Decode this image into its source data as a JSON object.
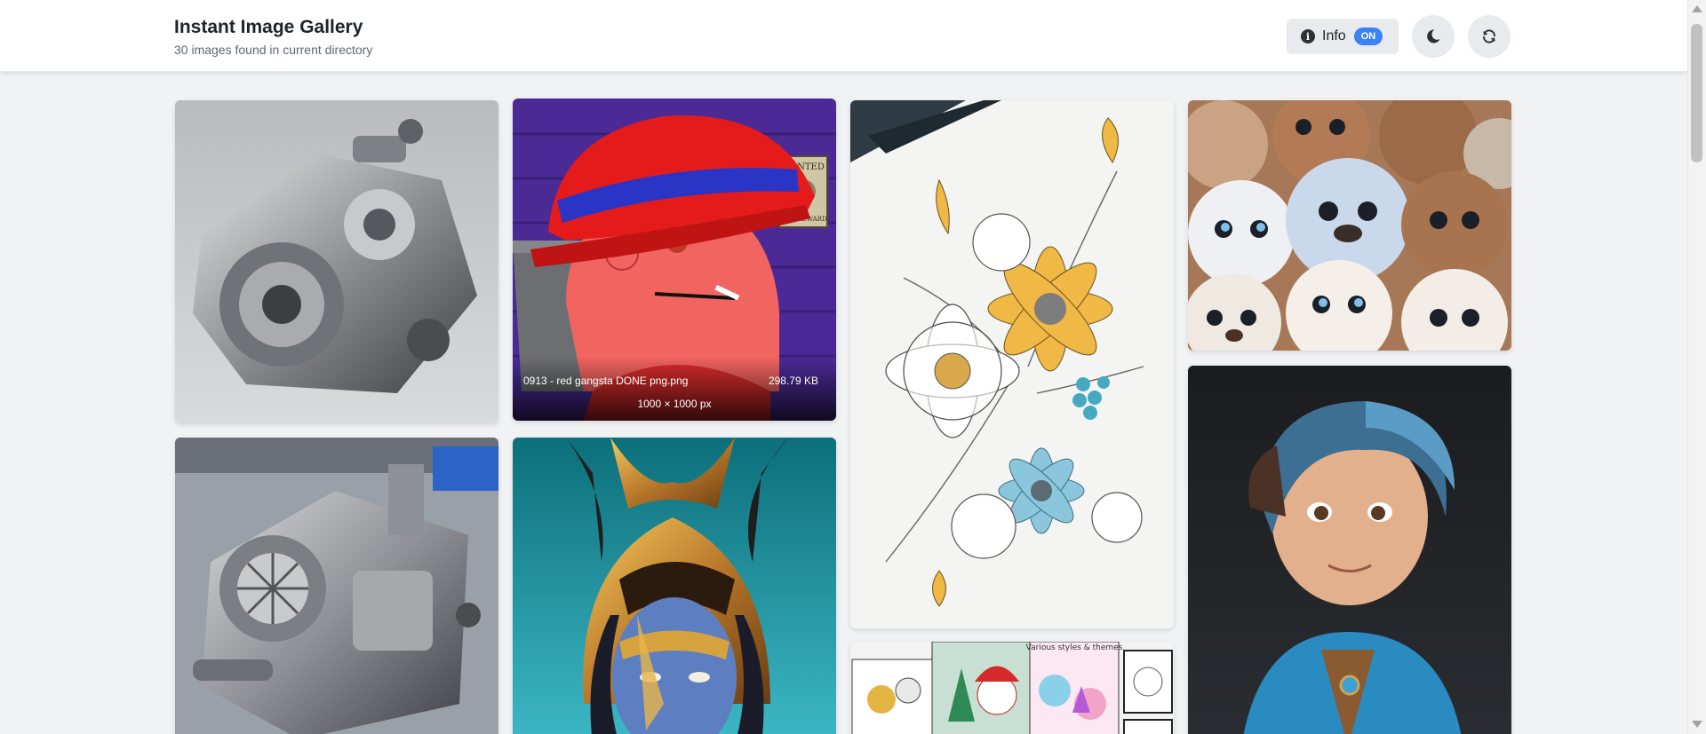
{
  "header": {
    "title": "Instant Image Gallery",
    "subtitle": "30 images found in current directory"
  },
  "controls": {
    "info_label": "Info",
    "info_toggle": "ON",
    "info_icon": "info-circle-icon",
    "theme_icon": "moon-icon",
    "refresh_icon": "refresh-icon"
  },
  "gallery": {
    "images": [
      {
        "subject": "metal-machine-part"
      },
      {
        "subject": "red-gangsta-cartoon",
        "filename": "0913 - red gangsta DONE png.png",
        "size": "298.79 KB",
        "dimensions": "1000 × 1000 px",
        "poster_title": "WANTED",
        "poster_reward": "$500 REWARD"
      },
      {
        "subject": "floral-coloring-page"
      },
      {
        "subject": "cute-fluffy-creatures"
      },
      {
        "subject": "metal-gearbox-part"
      },
      {
        "subject": "golden-crowned-warrior"
      },
      {
        "subject": "coloring-books-collage",
        "banner_text": "Various styles & themes"
      },
      {
        "subject": "blue-haired-figurine"
      }
    ]
  }
}
